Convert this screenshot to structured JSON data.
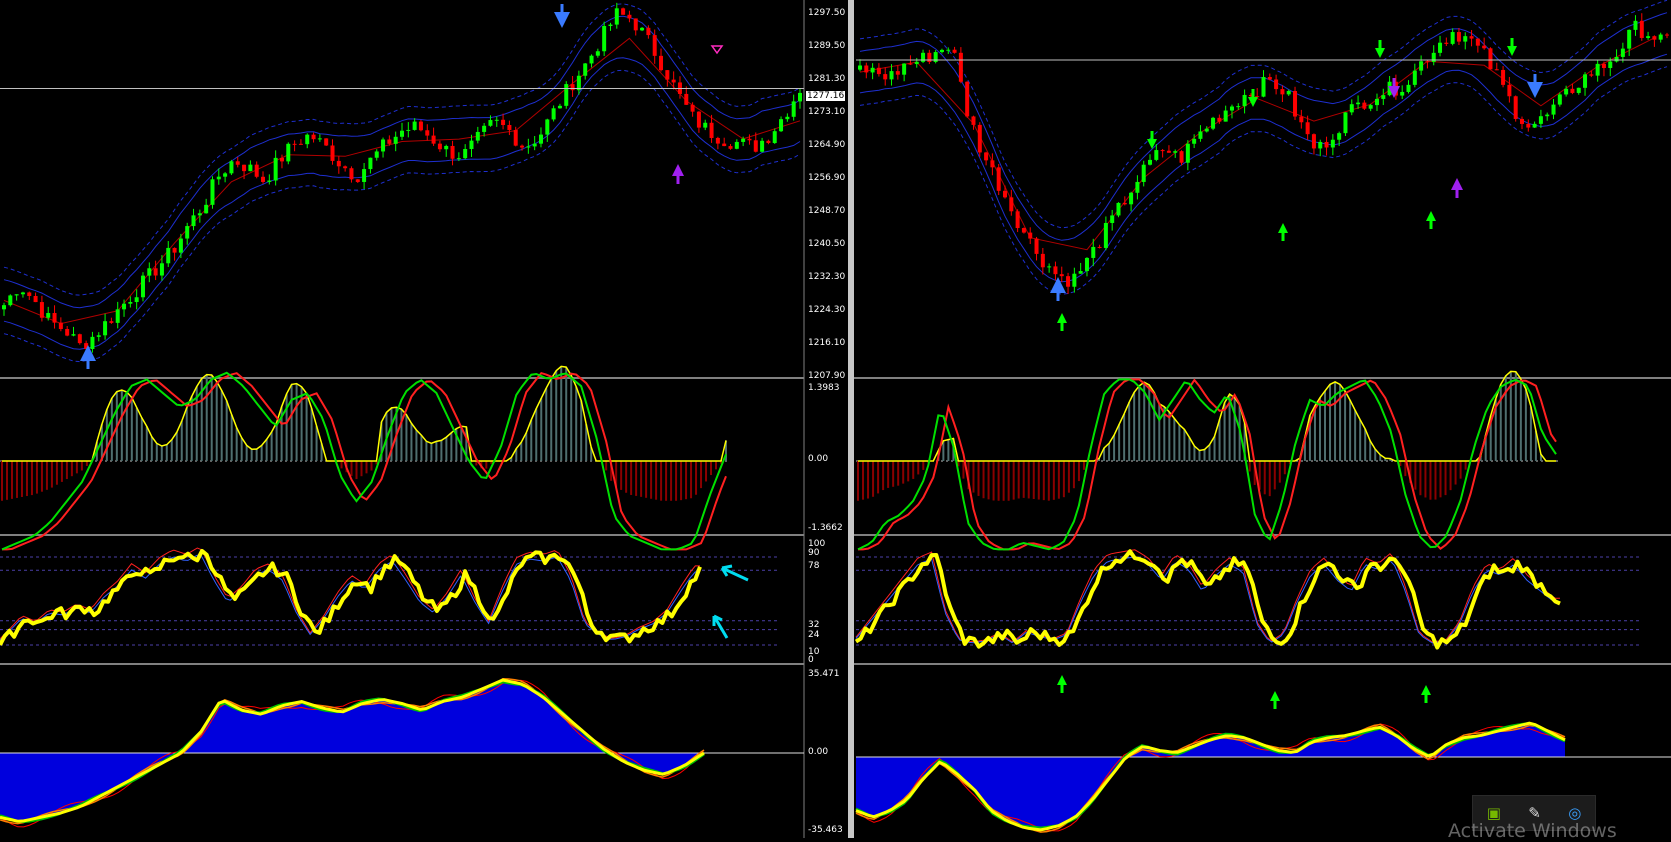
{
  "colors": {
    "background": "#000000",
    "bull_candle": "#00ff00",
    "bear_candle": "#ff0000",
    "envelope_inner": "#1e2fcf",
    "envelope_outer": "#1e2fcf",
    "price_line": "#c0c0c0",
    "macd_bull_hist": "#4f6f6f",
    "macd_bear_hist": "#8b0000",
    "macd_fast": "#00e000",
    "macd_slow": "#ff2020",
    "macd_outline": "#ffff00",
    "stoch_main": "#ffff00",
    "stoch_signal_red": "#ff2020",
    "stoch_signal_blue": "#3060ff",
    "level_line": "#4b3fa8",
    "osc_area": "#0000dd",
    "osc_yellow": "#ffff00",
    "osc_green": "#00c000",
    "osc_orange": "#ff8000",
    "osc_red": "#ff0000",
    "arrow_blue": "#3a7bff",
    "arrow_purple": "#a020f0",
    "arrow_magenta": "#ff2cc0",
    "arrow_green": "#00ff00",
    "arrow_cyan": "#00dcf0",
    "separator": "#808080"
  },
  "left_chart": {
    "price_axis": [
      "1297.50",
      "1289.50",
      "1281.30",
      "1273.10",
      "1264.90",
      "1256.90",
      "1248.70",
      "1240.50",
      "1232.30",
      "1224.30",
      "1216.10",
      "1207.90"
    ],
    "current_price": "1277.16",
    "price_range": [
      1207.9,
      1297.5
    ],
    "macd_axis": [
      "1.3983",
      "0.00",
      "-1.3662"
    ],
    "macd_range": [
      -1.3662,
      1.3983
    ],
    "stoch_axis": [
      "100",
      "90",
      "78",
      "32",
      "24",
      "10",
      "0"
    ],
    "stoch_levels": [
      90,
      78,
      32,
      24,
      10
    ],
    "osc_axis": [
      "35.471",
      "0.00",
      "-35.463"
    ],
    "osc_range": [
      -35.463,
      35.471
    ],
    "price_path": [
      1225,
      1230,
      1226,
      1221,
      1219,
      1215,
      1218,
      1222,
      1226,
      1230,
      1234,
      1238,
      1244,
      1249,
      1256,
      1260,
      1258,
      1255,
      1260,
      1264,
      1266,
      1263,
      1259,
      1256,
      1260,
      1264,
      1267,
      1268,
      1265,
      1262,
      1261,
      1265,
      1269,
      1267,
      1263,
      1266,
      1272,
      1278,
      1283,
      1289,
      1295,
      1294,
      1289,
      1283,
      1276,
      1270,
      1267,
      1265,
      1264,
      1263,
      1266,
      1271,
      1277.16
    ],
    "macd_fast_path": [
      -1.3,
      -1.2,
      -1.1,
      -0.9,
      -0.6,
      -0.3,
      0.2,
      0.7,
      1.1,
      1.2,
      1.0,
      0.8,
      0.9,
      1.2,
      1.3,
      1.1,
      0.8,
      0.5,
      0.9,
      1.0,
      0.6,
      -0.2,
      -0.6,
      -0.3,
      0.4,
      1.0,
      1.2,
      1.0,
      0.5,
      0.0,
      -0.3,
      0.2,
      1.0,
      1.3,
      1.2,
      1.3,
      1.1,
      0.3,
      -0.8,
      -1.1,
      -1.2,
      -1.3,
      -1.3,
      -1.2,
      -0.5,
      0.1
    ],
    "stoch_path": [
      10,
      22,
      35,
      30,
      40,
      38,
      45,
      40,
      55,
      65,
      80,
      72,
      85,
      92,
      88,
      95,
      70,
      50,
      60,
      75,
      80,
      70,
      40,
      20,
      35,
      55,
      70,
      62,
      80,
      88,
      70,
      50,
      40,
      55,
      75,
      50,
      30,
      60,
      85,
      90,
      88,
      92,
      70,
      30,
      20,
      15,
      18,
      25,
      30,
      40,
      60,
      78
    ],
    "osc_path": [
      -30,
      -32,
      -30,
      -28,
      -25,
      -20,
      -15,
      -10,
      -5,
      0,
      10,
      25,
      20,
      18,
      22,
      24,
      21,
      19,
      23,
      25,
      23,
      20,
      24,
      26,
      30,
      34,
      32,
      26,
      18,
      10,
      2,
      -4,
      -8,
      -10,
      -6,
      0
    ]
  },
  "right_chart": {
    "price_path": [
      1282,
      1281,
      1280,
      1283,
      1284,
      1286,
      1288,
      1272,
      1262,
      1255,
      1248,
      1241,
      1236,
      1232,
      1231,
      1236,
      1242,
      1248,
      1254,
      1259,
      1263,
      1260,
      1265,
      1269,
      1272,
      1275,
      1277,
      1279,
      1276,
      1268,
      1262,
      1266,
      1271,
      1274,
      1276,
      1277,
      1279,
      1284,
      1288,
      1291,
      1289,
      1285,
      1279,
      1272,
      1268,
      1270,
      1274,
      1278,
      1281,
      1283,
      1287,
      1292,
      1290,
      1288
    ],
    "current_price": 1284,
    "macd_fast_path": [
      -1.3,
      -1.2,
      -0.9,
      -0.8,
      -0.6,
      -0.2,
      0.8,
      0.2,
      -0.9,
      -1.2,
      -1.3,
      -1.3,
      -1.2,
      -1.25,
      -1.3,
      -1.2,
      -0.8,
      0.2,
      1.0,
      1.2,
      1.2,
      1.0,
      0.6,
      0.9,
      1.2,
      0.9,
      0.7,
      1.0,
      0.4,
      -0.8,
      -1.2,
      -0.6,
      0.3,
      0.9,
      0.8,
      1.0,
      1.1,
      1.2,
      0.9,
      0.4,
      -0.5,
      -1.1,
      -1.3,
      -1.1,
      -0.6,
      0.2,
      0.8,
      1.1,
      1.2,
      1.1,
      0.4,
      0.1
    ],
    "stoch_path": [
      10,
      25,
      40,
      55,
      70,
      85,
      90,
      40,
      15,
      12,
      14,
      20,
      12,
      22,
      18,
      15,
      20,
      50,
      75,
      88,
      90,
      92,
      85,
      70,
      88,
      80,
      60,
      75,
      85,
      78,
      30,
      12,
      20,
      50,
      75,
      85,
      70,
      60,
      85,
      80,
      90,
      60,
      20,
      12,
      14,
      30,
      60,
      80,
      75,
      85,
      70,
      60,
      50
    ],
    "osc_path": [
      -25,
      -28,
      -25,
      -20,
      -10,
      -2,
      -8,
      -15,
      -25,
      -30,
      -33,
      -34,
      -32,
      -28,
      -20,
      -10,
      0,
      5,
      3,
      2,
      5,
      8,
      10,
      9,
      6,
      3,
      2,
      7,
      9,
      10,
      12,
      14,
      10,
      4,
      0,
      6,
      9,
      10,
      12,
      14,
      16,
      12,
      8
    ],
    "sell_arrows_green": [
      1080,
      1308,
      1440
    ],
    "buy_arrows_green": [
      996,
      1217,
      1365
    ],
    "stoch_buy_arrows": [
      998,
      1211,
      1362
    ]
  },
  "taskbar": {
    "icons": [
      "nvidia-icon",
      "screen-tool-icon",
      "network-icon"
    ],
    "glyphs": [
      "▣",
      "✎",
      "◎"
    ]
  },
  "watermark": {
    "text": "Activate Windows"
  }
}
